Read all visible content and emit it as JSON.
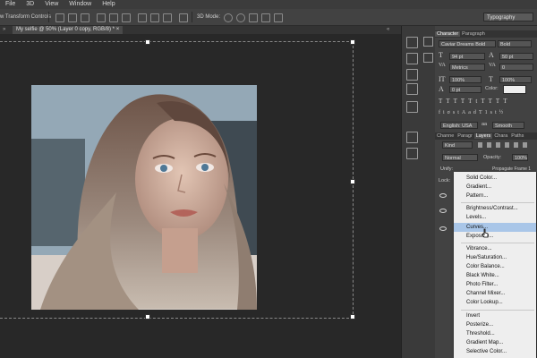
{
  "menubar": {
    "items": [
      "File",
      "3D",
      "View",
      "Window",
      "Help"
    ]
  },
  "options_bar": {
    "transform_controls_label": "w Transform Controls",
    "mode_3d_label": "3D Mode:",
    "workspace": "Typography"
  },
  "document_tab": {
    "title": "My selfie @ 50% (Layer 0 copy, RGB/8) *",
    "close": "×"
  },
  "character_panel": {
    "tabs": [
      "Character",
      "Paragraph"
    ],
    "font_family": "Caviar Dreams Bold",
    "font_style": "Bold",
    "font_size": "94 pt",
    "leading": "50 pt",
    "kerning": "Metrics",
    "tracking": "0",
    "vertical_scale": "100%",
    "horizontal_scale": "100%",
    "baseline_shift": "0 pt",
    "color_label": "Color:",
    "glyph_buttons": [
      "T",
      "T",
      "TT",
      "Tt",
      "T",
      "T",
      "T",
      "T"
    ],
    "extra_buttons": [
      "fi",
      "σ",
      "st",
      "A",
      "ad",
      "T",
      "1st",
      "½"
    ],
    "language": "English: USA",
    "anti_alias_icon": "aa",
    "anti_alias": "Smooth",
    "accent_color": "#eeeeee"
  },
  "layers_panel": {
    "tabs": [
      "Channe",
      "Paragr",
      "Layers",
      "Chara",
      "Paths"
    ],
    "kind": "Kind",
    "blend_mode": "Normal",
    "opacity_label": "Opacity:",
    "opacity": "100%",
    "unify_label": "Unify:",
    "propagate_label": "Propagate Frame 1",
    "lock_label": "Lock:"
  },
  "adjustment_menu": {
    "highlighted": "Curves...",
    "highlight_color": "#a9c6e8",
    "groups": [
      [
        "Solid Color...",
        "Gradient...",
        "Pattern..."
      ],
      [
        "Brightness/Contrast...",
        "Levels...",
        "Curves...",
        "Exposure..."
      ],
      [
        "Vibrance...",
        "Hue/Saturation...",
        "Color Balance...",
        "Black  White...",
        "Photo Filter...",
        "Channel Mixer...",
        "Color Lookup..."
      ],
      [
        "Invert",
        "Posterize...",
        "Threshold...",
        "Gradient Map...",
        "Selective Color..."
      ]
    ]
  }
}
